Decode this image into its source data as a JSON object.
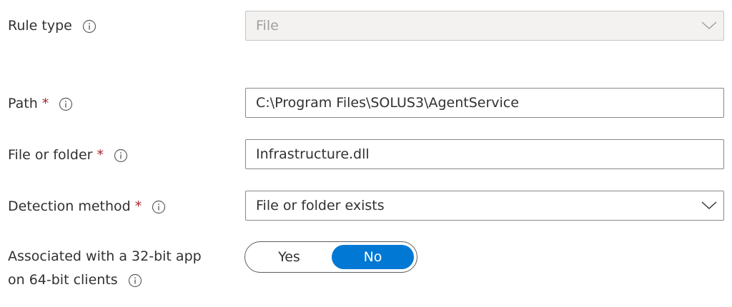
{
  "rule_type": {
    "label": "Rule type",
    "value": "File"
  },
  "path": {
    "label": "Path",
    "required": "*",
    "value": "C:\\Program Files\\SOLUS3\\AgentService"
  },
  "file_or_folder": {
    "label": "File or folder",
    "required": "*",
    "value": "Infrastructure.dll"
  },
  "detection_method": {
    "label": "Detection method",
    "required": "*",
    "value": "File or folder exists"
  },
  "associated_32bit": {
    "label_line1": "Associated with a 32-bit app",
    "label_line2": "on 64-bit clients",
    "options": [
      "Yes",
      "No"
    ],
    "selected": "No"
  },
  "colors": {
    "accent": "#0078d4",
    "required": "#a4262c"
  }
}
